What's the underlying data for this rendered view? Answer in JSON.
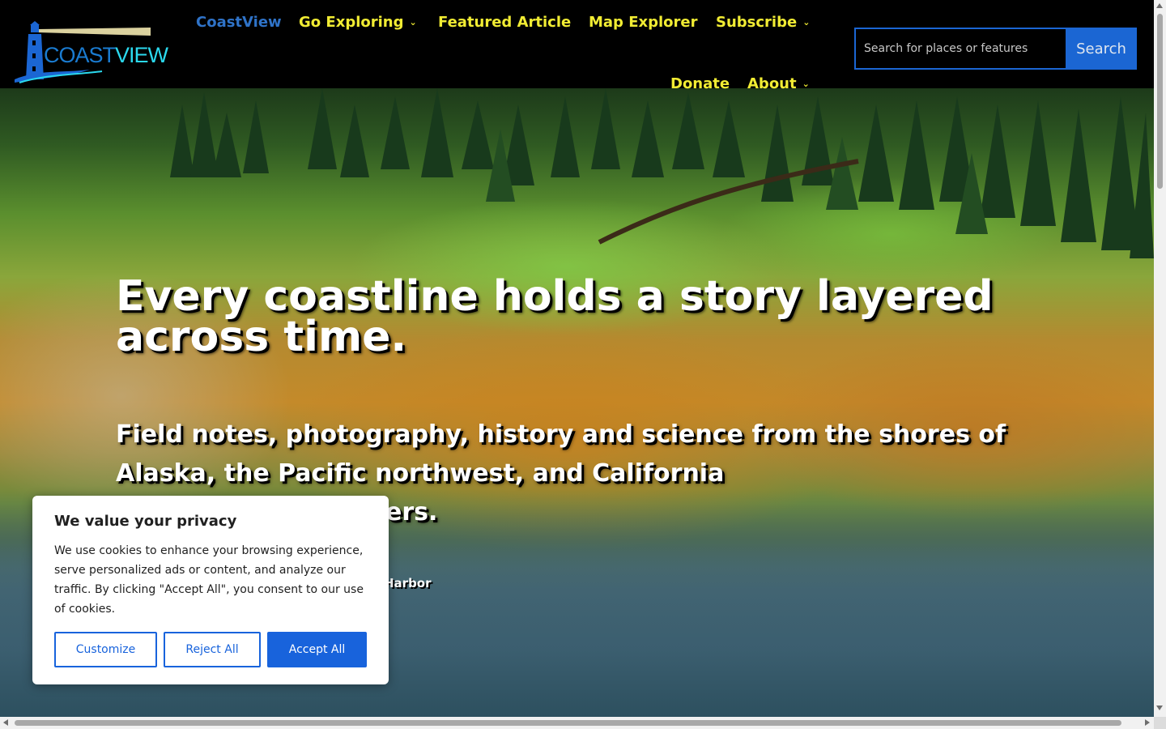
{
  "header": {
    "logo": {
      "coast": "COAST",
      "view": "VIEW",
      "icon": "lighthouse-icon"
    },
    "nav": [
      {
        "label": "CoastView",
        "active": true
      },
      {
        "label": "Go Exploring",
        "dropdown": true
      },
      {
        "label": "Featured Article"
      },
      {
        "label": "Map Explorer"
      },
      {
        "label": "Subscribe",
        "dropdown": true
      },
      {
        "label": "Donate"
      },
      {
        "label": "About",
        "dropdown": true
      }
    ],
    "search": {
      "placeholder": "Search for places or features",
      "button_label": "Search"
    }
  },
  "hero": {
    "title": "Every coastline holds a story layered across time.",
    "subtitle": "Field notes, photography, history and science from the shores of Alaska, the Pacific northwest, and California",
    "subtitle_partial": "ers.",
    "photo_credit_partial": "Harbor"
  },
  "cookie_banner": {
    "title": "We value your privacy",
    "text": "We use cookies to enhance your browsing experience, serve personalized ads or content, and analyze our traffic. By clicking \"Accept All\", you consent to our use of cookies.",
    "buttons": {
      "customize": "Customize",
      "reject": "Reject All",
      "accept": "Accept All"
    }
  },
  "colors": {
    "nav_text": "#f1ec33",
    "nav_active": "#2f73c8",
    "accent_blue": "#1863dc",
    "header_bg": "#000000"
  }
}
